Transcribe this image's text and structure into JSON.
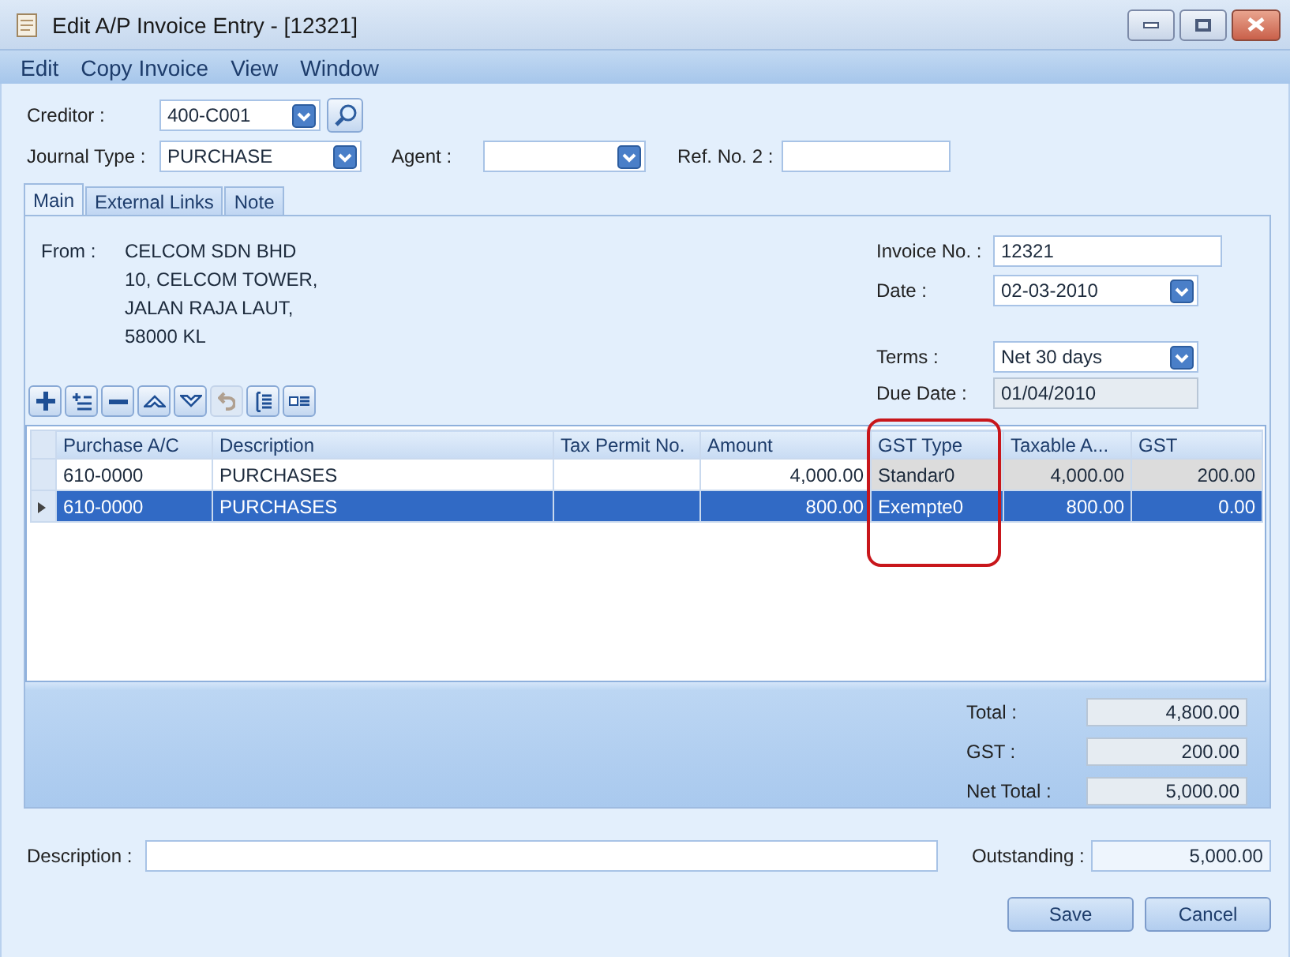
{
  "window": {
    "title": "Edit A/P Invoice Entry - [12321]"
  },
  "menu": [
    "Edit",
    "Copy Invoice",
    "View",
    "Window"
  ],
  "header": {
    "creditor": {
      "label": "Creditor :",
      "value": "400-C001"
    },
    "journal_type": {
      "label": "Journal Type :",
      "value": "PURCHASE"
    },
    "agent": {
      "label": "Agent :"
    },
    "ref_no_2": {
      "label": "Ref. No. 2 :"
    }
  },
  "tabs": [
    {
      "label": "Main",
      "selected": true
    },
    {
      "label": "External Links",
      "selected": false
    },
    {
      "label": "Note",
      "selected": false
    }
  ],
  "from": {
    "label": "From :",
    "lines": [
      "CELCOM SDN BHD",
      "10, CELCOM TOWER,",
      "JALAN RAJA LAUT,",
      "58000 KL"
    ]
  },
  "invoice": {
    "invoice_no": {
      "label": "Invoice No. :",
      "value": "12321"
    },
    "date": {
      "label": "Date :",
      "value": "02-03-2010"
    },
    "terms": {
      "label": "Terms :",
      "value": "Net 30 days"
    },
    "due_date": {
      "label": "Due Date :",
      "value": "01/04/2010"
    }
  },
  "grid_toolbar": [
    {
      "kind": "add"
    },
    {
      "kind": "insert"
    },
    {
      "kind": "remove"
    },
    {
      "kind": "up"
    },
    {
      "kind": "down"
    },
    {
      "kind": "undo",
      "disabled": true
    },
    {
      "kind": "list"
    },
    {
      "kind": "detail"
    }
  ],
  "table": {
    "columns": [
      {
        "label": "Purchase A/C",
        "kind": "text",
        "readonly": false,
        "highlighted": false
      },
      {
        "label": "Description",
        "kind": "text",
        "readonly": false,
        "highlighted": false
      },
      {
        "label": "Tax Permit No.",
        "kind": "text",
        "readonly": false,
        "highlighted": false
      },
      {
        "label": "Amount",
        "kind": "number",
        "readonly": false,
        "highlighted": false
      },
      {
        "label": "GST Type",
        "kind": "text",
        "readonly": true,
        "highlighted": true
      },
      {
        "label": "Taxable A...",
        "kind": "number",
        "readonly": true,
        "highlighted": false
      },
      {
        "label": "GST",
        "kind": "number",
        "readonly": true,
        "highlighted": false
      }
    ],
    "rows": [
      {
        "selected": false,
        "cells": [
          "610-0000",
          "PURCHASES",
          "",
          "4,000.00",
          "Standar0",
          "4,000.00",
          "200.00"
        ]
      },
      {
        "selected": true,
        "cells": [
          "610-0000",
          "PURCHASES",
          "",
          "800.00",
          "Exempte0",
          "800.00",
          "0.00"
        ]
      }
    ]
  },
  "totals": [
    {
      "label": "Total :",
      "value": "4,800.00"
    },
    {
      "label": "GST :",
      "value": "200.00"
    },
    {
      "label": "Net Total :",
      "value": "5,000.00"
    }
  ],
  "footer": {
    "description": {
      "label": "Description :"
    },
    "outstanding": {
      "label": "Outstanding :",
      "value": "5,000.00"
    }
  },
  "buttons": [
    "Save",
    "Cancel"
  ]
}
